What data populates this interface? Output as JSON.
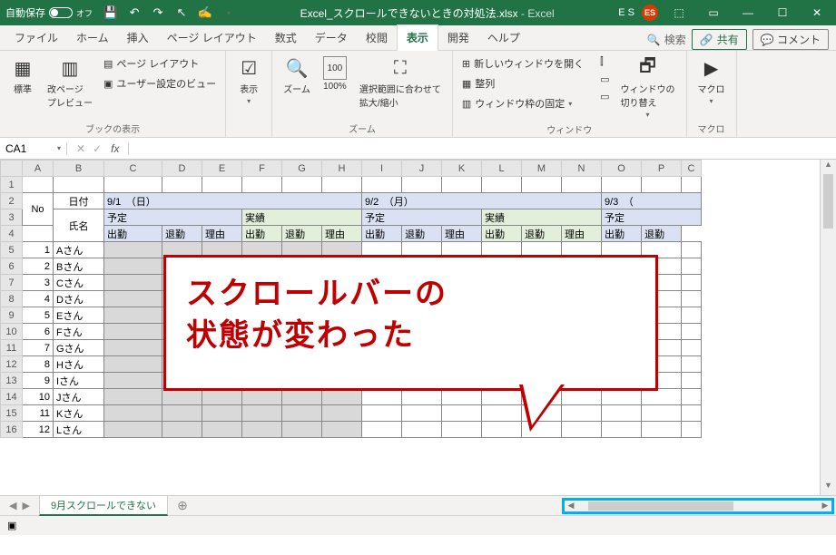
{
  "titlebar": {
    "autosave_label": "自動保存",
    "autosave_state": "オフ",
    "filename": "Excel_スクロールできないときの対処法.xlsx",
    "appname": "Excel",
    "user_initials": "E S",
    "avatar": "ES"
  },
  "tabs": {
    "items": [
      "ファイル",
      "ホーム",
      "挿入",
      "ページ レイアウト",
      "数式",
      "データ",
      "校閲",
      "表示",
      "開発",
      "ヘルプ"
    ],
    "active": "表示",
    "search": "検索",
    "share": "共有",
    "comment": "コメント"
  },
  "ribbon": {
    "group1": {
      "label": "ブックの表示",
      "standard": "標準",
      "preview": "改ページ\nプレビュー",
      "page_layout": "ページ レイアウト",
      "custom_view": "ユーザー設定のビュー"
    },
    "group2": {
      "label": "",
      "display": "表示"
    },
    "group3": {
      "label": "ズーム",
      "zoom": "ズーム",
      "hundred": "100%",
      "fit": "選択範囲に合わせて\n拡大/縮小"
    },
    "group4": {
      "label": "ウィンドウ",
      "new_window": "新しいウィンドウを開く",
      "arrange": "整列",
      "freeze": "ウィンドウ枠の固定",
      "switch": "ウィンドウの\n切り替え"
    },
    "group5": {
      "label": "マクロ",
      "macro": "マクロ"
    }
  },
  "formula": {
    "name_box": "CA1",
    "fx": "fx"
  },
  "columns": [
    "A",
    "B",
    "C",
    "D",
    "E",
    "F",
    "G",
    "H",
    "I",
    "J",
    "K",
    "L",
    "M",
    "N",
    "O",
    "P",
    "C"
  ],
  "header": {
    "no": "No",
    "date_label": "日付",
    "name_label": "氏名",
    "dates": [
      "9/1　（日）",
      "9/2　（月）",
      "9/3　（"
    ],
    "plan": "予定",
    "actual": "実績",
    "in": "出勤",
    "out": "退勤",
    "reason": "理由"
  },
  "rows": [
    {
      "no": 1,
      "name": "Aさん"
    },
    {
      "no": 2,
      "name": "Bさん"
    },
    {
      "no": 3,
      "name": "Cさん"
    },
    {
      "no": 4,
      "name": "Dさん"
    },
    {
      "no": 5,
      "name": "Eさん"
    },
    {
      "no": 6,
      "name": "Fさん"
    },
    {
      "no": 7,
      "name": "Gさん"
    },
    {
      "no": 8,
      "name": "Hさん"
    },
    {
      "no": 9,
      "name": "Iさん"
    },
    {
      "no": 10,
      "name": "Jさん"
    },
    {
      "no": 11,
      "name": "Kさん"
    },
    {
      "no": 12,
      "name": "Lさん"
    }
  ],
  "callout": {
    "line1": "スクロールバーの",
    "line2": "状態が変わった"
  },
  "sheet_tab": "9月スクロールできない",
  "status": ""
}
